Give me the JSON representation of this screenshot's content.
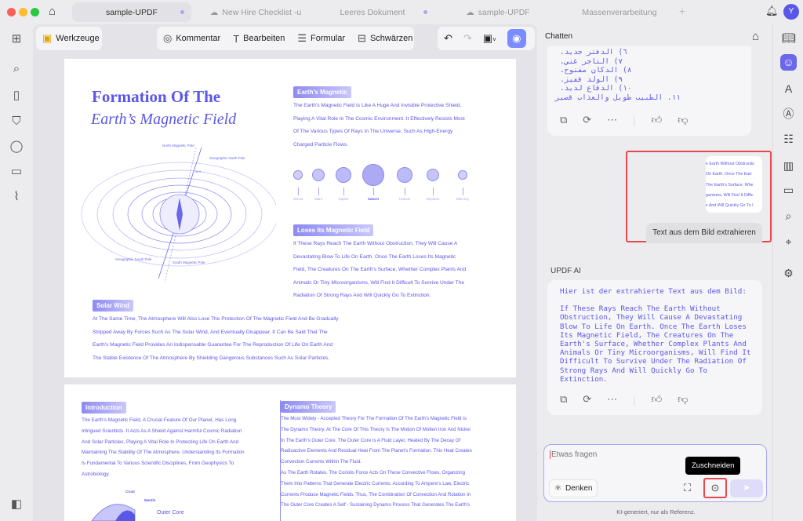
{
  "tabs": [
    {
      "label": "sample-UPDF",
      "active": true
    },
    {
      "label": "New Hire Checklist -u"
    },
    {
      "label": "Leeres Dokument"
    },
    {
      "label": "sample-UPDF"
    },
    {
      "label": "Massenverarbeitung"
    }
  ],
  "user_initial": "Y",
  "toolbar": {
    "tools": "Werkzeuge",
    "comment": "Kommentar",
    "edit": "Bearbeiten",
    "form": "Formular",
    "redact": "Schwärzen"
  },
  "doc": {
    "title1": "Formation Of The",
    "title2": "Earth’s Magnetic Field",
    "diagram_labels": {
      "nmp": "North Magnetic Pole",
      "gnp": "Geographic North Pole",
      "gsp": "Geographic South Pole",
      "smp": "South Magnetic Pole",
      "angle": "11.5"
    },
    "sec1_title": "Earth's Magnetic",
    "sec1_lines": [
      "The Earth's Magnetic Field Is Like A Huge And Invisible Protective Shield,",
      "Playing A Vital Role In The Cosmic Environment. It Effectively Resists Most",
      "Of The Various Types Of Rays In The Universe, Such As High-Energy",
      "Charged Particle Flows."
    ],
    "planets": [
      "Venus",
      "Mars",
      "Jupiter",
      "Saturn",
      "Uranus",
      "Neptune",
      "Mercury"
    ],
    "sec2_title": "Loses Its Magnetic Field",
    "sec2_lines": [
      "If These Rays Reach The Earth Without Obstruction, They Will Cause A",
      "Devastating Blow To Life On Earth. Once The Earth Loses Its Magnetic",
      "Field, The Creatures On The Earth's Surface, Whether Complex Plants And",
      "Animals Or Tiny Microorganisms, Will Find It Difficult To Survive Under The",
      "Radiation Of Strong Rays And Will Quickly Go To Extinction."
    ],
    "sec3_title": "Solar Wind",
    "sec3_lines": [
      "At The Same Time, The Atmosphere Will Also Lose The Protection Of The Magnetic Field And Be Gradually",
      "Stripped Away By Forces Such As The Solar Wind, And Eventually Disappear. It Can Be Said That The",
      "Earth's Magnetic Field Provides An Indispensable Guarantee For The Reproduction Of Life On Earth And",
      "The Stable Existence Of The Atmosphere By Shielding Dangerous Substances Such As Solar Particles."
    ],
    "intro_title": "Introduction",
    "intro_lines": [
      "The Earth's Magnetic Field, A Crucial Feature Of Our Planet, Has Long",
      "Intrigued Scientists. It Acts As A Shield Against Harmful Cosmic Radiation",
      "And Solar Particles, Playing A Vital Role In Protecting Life On Earth And",
      "Maintaining The Stability Of The Atmosphere. Understanding Its Formation",
      "Is Fundamental To Various Scientific Disciplines, From Geophysics To",
      "Astrobiology."
    ],
    "layers": {
      "crust": "Crust",
      "mantle": "Mantle",
      "outer": "Outer Core"
    },
    "dynamo_title": "Dynamo Theory",
    "dynamo_lines": [
      "The Most Widely - Accepted Theory For The Formation Of The Earth's Magnetic Field Is",
      "The Dynamo Theory. At The Core Of This Theory Is The Motion Of Molten Iron And Nickel",
      "In The Earth's Outer Core. The Outer Core Is A Fluid Layer, Heated By The Decay Of",
      "Radioactive Elements And Residual Heat From The Planet's Formation. This Heat Creates",
      "Convection Currents Within The Fluid.",
      "As The Earth Rotates, The Coriolis Force Acts On These Convective Flows, Organizing",
      "Them Into Patterns That Generate Electric Currents. According To Ampere's Law, Electric",
      "Currents Produce Magnetic Fields. Thus, The Combination Of Convection And Rotation In",
      "The Outer Core Creates A Self - Sustaining Dynamo Process That Generates The Earth's"
    ]
  },
  "chat": {
    "title": "Chatten",
    "arabic_lines": [
      "٦) الدفتر جديد.",
      "٧) التاجر غني.",
      "٨) الدكان مفتوح.",
      "٩) الولد قفيز.",
      "١٠) الدقاع لذيذ.",
      "١١. الطبيب طويل والعذاب قصير"
    ],
    "image_lines": [
      "e Earth Without Obstructio",
      "On Earth. Once The Eart",
      "The Earth's Surface, Whe",
      "ganisms, Will Find It Diffic",
      "s And Will Quickly Go To I"
    ],
    "user_msg": "Text aus dem Bild extrahieren",
    "ai_label": "UPDF AI",
    "ai_intro": "Hier ist der extrahierte Text aus dem Bild:",
    "ai_body": "If These Rays Reach The Earth Without Obstruction, They Will Cause A Devastating Blow To Life On Earth. Once The Earth Loses Its Magnetic Field, The Creatures On The Earth's Surface, Whether Complex Plants And Animals Or Tiny Microorganisms, Will Find It Difficult To Survive Under The Radiation Of Strong Rays And Will Quickly Go To Extinction.",
    "input_placeholder": "Etwas fragen",
    "think_label": "Denken",
    "tooltip": "Zuschneiden",
    "disclaimer": "KI-generiert, nur als Referenz."
  },
  "colors": {
    "accent": "#5b57e6",
    "highlight": "#e5484d"
  }
}
